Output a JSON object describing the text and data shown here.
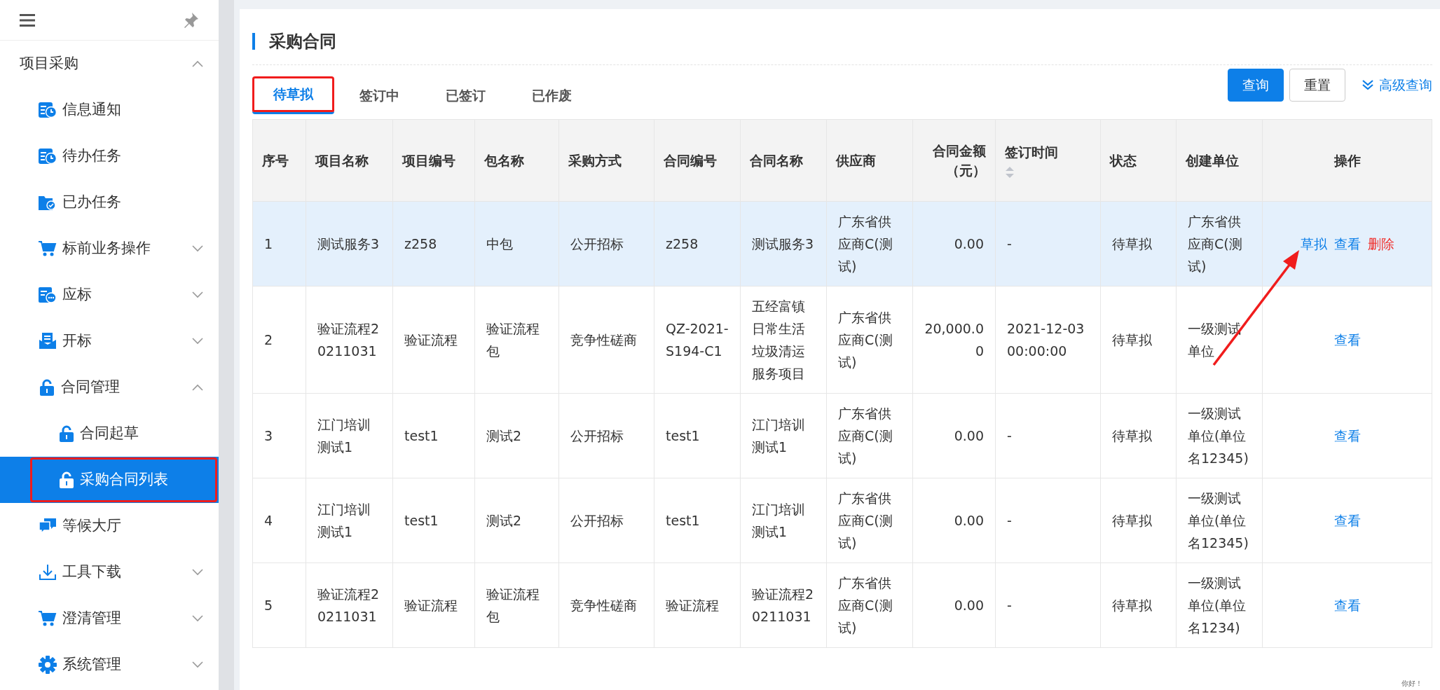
{
  "sidebar": {
    "items": [
      {
        "label": "项目采购",
        "expanded": true,
        "selected": false,
        "highlighted": false,
        "children": [
          {
            "label": "信息通知",
            "selected": false,
            "highlighted": false
          },
          {
            "label": "待办任务",
            "selected": false,
            "highlighted": false
          },
          {
            "label": "已办任务",
            "selected": false,
            "highlighted": false
          },
          {
            "label": "标前业务操作",
            "expanded": false,
            "selected": false,
            "highlighted": false
          },
          {
            "label": "应标",
            "expanded": false,
            "selected": false,
            "highlighted": false
          },
          {
            "label": "开标",
            "expanded": false,
            "selected": false,
            "highlighted": false
          },
          {
            "label": "合同管理",
            "expanded": true,
            "selected": false,
            "highlighted": false,
            "children": [
              {
                "label": "合同起草",
                "selected": false,
                "highlighted": false
              },
              {
                "label": "采购合同列表",
                "selected": true,
                "highlighted": true
              }
            ]
          },
          {
            "label": "等候大厅",
            "selected": false,
            "highlighted": false
          },
          {
            "label": "工具下载",
            "expanded": false,
            "selected": false,
            "highlighted": false
          },
          {
            "label": "澄清管理",
            "expanded": false,
            "selected": false,
            "highlighted": false
          },
          {
            "label": "系统管理",
            "expanded": false,
            "selected": false,
            "highlighted": false
          }
        ]
      }
    ]
  },
  "page_title": "采购合同",
  "tabs": [
    {
      "label": "待草拟",
      "selected": true,
      "highlighted": true
    },
    {
      "label": "签订中",
      "selected": false,
      "highlighted": false
    },
    {
      "label": "已签订",
      "selected": false,
      "highlighted": false
    },
    {
      "label": "已作废",
      "selected": false,
      "highlighted": false
    }
  ],
  "toolbar": {
    "search_button": "查询",
    "reset_button": "重置",
    "advanced_link": "高级查询"
  },
  "table": {
    "columns": [
      {
        "label": "序号",
        "sortable": false
      },
      {
        "label": "项目名称",
        "sortable": false
      },
      {
        "label": "项目编号",
        "sortable": false
      },
      {
        "label": "包名称",
        "sortable": false
      },
      {
        "label": "采购方式",
        "sortable": false
      },
      {
        "label": "合同编号",
        "sortable": false
      },
      {
        "label": "合同名称",
        "sortable": false
      },
      {
        "label": "供应商",
        "sortable": false
      },
      {
        "label": "合同金额（元）",
        "sortable": false
      },
      {
        "label": "签订时间",
        "sortable": true
      },
      {
        "label": "状态",
        "sortable": false
      },
      {
        "label": "创建单位",
        "sortable": false
      },
      {
        "label": "操作",
        "sortable": false
      }
    ],
    "rows": [
      {
        "selected": true,
        "cells": [
          "1",
          "测试服务3",
          "z258",
          "中包",
          "公开招标",
          "z258",
          "测试服务3",
          "广东省供应商C(测试)",
          "0.00",
          "-",
          "待草拟",
          "广东省供应商C(测试)"
        ],
        "actions": [
          {
            "label": "草拟",
            "kind": "link"
          },
          {
            "label": "查看",
            "kind": "link"
          },
          {
            "label": "删除",
            "kind": "danger"
          }
        ]
      },
      {
        "selected": false,
        "cells": [
          "2",
          "验证流程20211031",
          "验证流程",
          "验证流程包",
          "竞争性磋商",
          "QZ-2021-S194-C1",
          "五经富镇日常生活垃圾清运服务项目",
          "广东省供应商C(测试)",
          "20,000.00",
          "2021-12-03 00:00:00",
          "待草拟",
          "一级测试单位"
        ],
        "actions": [
          {
            "label": "查看",
            "kind": "link"
          }
        ]
      },
      {
        "selected": false,
        "cells": [
          "3",
          "江门培训测试1",
          "test1",
          "测试2",
          "公开招标",
          "test1",
          "江门培训测试1",
          "广东省供应商C(测试)",
          "0.00",
          "-",
          "待草拟",
          "一级测试单位(单位名12345)"
        ],
        "actions": [
          {
            "label": "查看",
            "kind": "link"
          }
        ]
      },
      {
        "selected": false,
        "cells": [
          "4",
          "江门培训测试1",
          "test1",
          "测试2",
          "公开招标",
          "test1",
          "江门培训测试1",
          "广东省供应商C(测试)",
          "0.00",
          "-",
          "待草拟",
          "一级测试单位(单位名12345)"
        ],
        "actions": [
          {
            "label": "查看",
            "kind": "link"
          }
        ]
      },
      {
        "selected": false,
        "cells": [
          "5",
          "验证流程20211031",
          "验证流程",
          "验证流程包",
          "竞争性磋商",
          "验证流程",
          "验证流程20211031",
          "广东省供应商C(测试)",
          "0.00",
          "-",
          "待草拟",
          "一级测试单位(单位名1234)"
        ],
        "actions": [
          {
            "label": "查看",
            "kind": "link"
          }
        ]
      }
    ]
  },
  "corner_note": "你好！"
}
